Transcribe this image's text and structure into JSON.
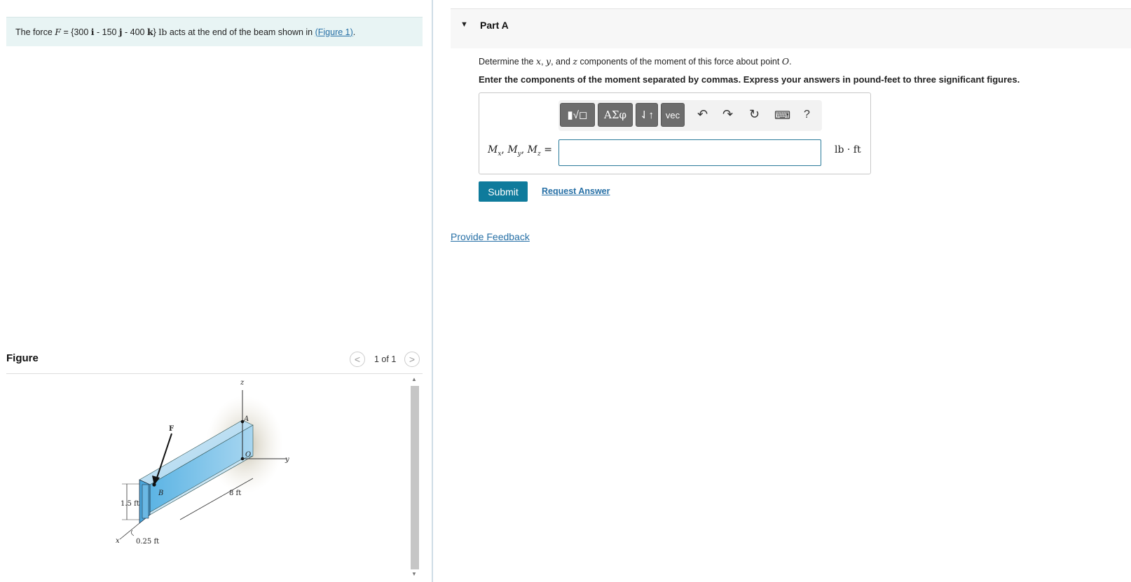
{
  "problem": {
    "prefix": "The force",
    "force_symbol": "F",
    "eq": "=",
    "open_brace": "{300",
    "i_unit": "i",
    "minus1": "- 150",
    "j_unit": "j",
    "minus2": "- 400",
    "k_unit": "k",
    "close_brace": "}",
    "lb": "lb",
    "suffix": "acts at the end of the beam shown in",
    "figure_link": "(Figure 1)",
    "period": "."
  },
  "figure": {
    "title": "Figure",
    "page_indicator": "1 of 1",
    "prev_icon": "chevron-left-icon",
    "next_icon": "chevron-right-icon",
    "labels": {
      "z": "z",
      "a": "A",
      "f": "F",
      "o": "O",
      "y": "y",
      "b": "B",
      "eight": "8 ft",
      "onefive": "1.5 ft",
      "x": "x",
      "quarter": "0.25 ft"
    }
  },
  "part": {
    "toggle_icon": "caret-down-icon",
    "title": "Part A"
  },
  "question": {
    "prefix": "Determine the",
    "x": "x",
    "comma1": ",",
    "y": "y",
    "and": ", and",
    "z": "z",
    "suffix": "components of the moment of this force about point",
    "o": "O",
    "period": "."
  },
  "instruction": "Enter the components of the moment separated by commas. Express your answers in pound-feet to three significant figures.",
  "toolbar": {
    "templates_label": "▮√◻",
    "greek_label": "ΑΣφ",
    "arrows_label": "⇃↑",
    "vec_label": "vec",
    "undo_icon": "↶",
    "redo_icon": "↷",
    "reset_icon": "↻",
    "keyboard_icon": "⌨",
    "help_icon": "?"
  },
  "answer": {
    "label": "Mx, My, Mz =",
    "value": "",
    "unit": "lb · ft"
  },
  "actions": {
    "submit": "Submit",
    "request_answer": "Request Answer",
    "provide_feedback": "Provide Feedback"
  }
}
